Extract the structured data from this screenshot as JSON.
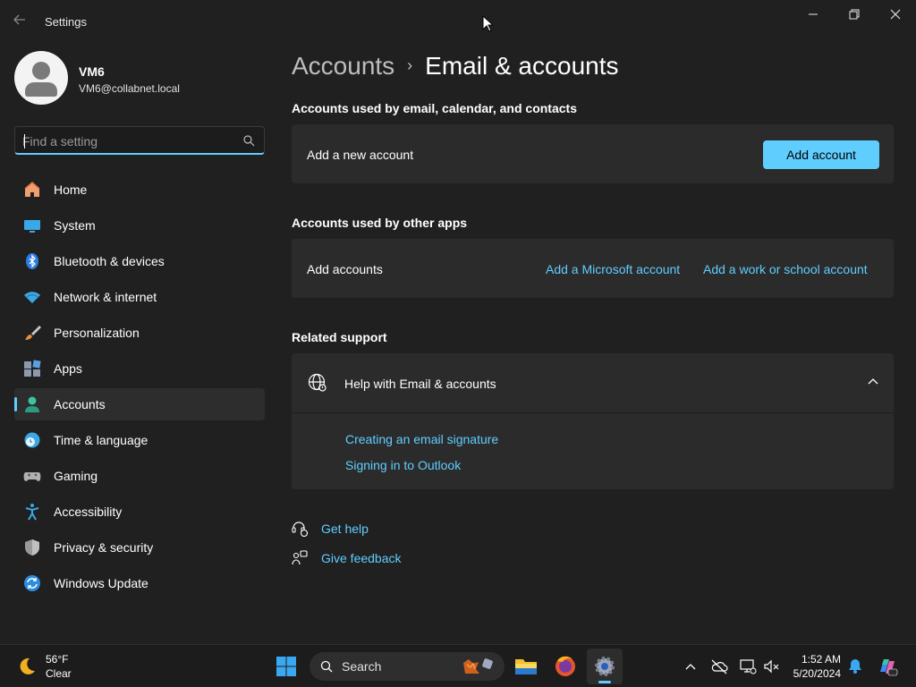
{
  "window": {
    "app_title": "Settings",
    "minimize_icon": "minimize-icon",
    "restore_icon": "restore-icon",
    "close_icon": "close-icon"
  },
  "profile": {
    "name": "VM6",
    "email": "VM6@collabnet.local"
  },
  "search": {
    "placeholder": "Find a setting",
    "value": ""
  },
  "sidebar": {
    "items": [
      {
        "label": "Home",
        "icon": "home-icon",
        "active": false
      },
      {
        "label": "System",
        "icon": "system-icon",
        "active": false
      },
      {
        "label": "Bluetooth & devices",
        "icon": "bluetooth-icon",
        "active": false
      },
      {
        "label": "Network & internet",
        "icon": "wifi-icon",
        "active": false
      },
      {
        "label": "Personalization",
        "icon": "brush-icon",
        "active": false
      },
      {
        "label": "Apps",
        "icon": "apps-icon",
        "active": false
      },
      {
        "label": "Accounts",
        "icon": "accounts-icon",
        "active": true
      },
      {
        "label": "Time & language",
        "icon": "clock-globe-icon",
        "active": false
      },
      {
        "label": "Gaming",
        "icon": "gamepad-icon",
        "active": false
      },
      {
        "label": "Accessibility",
        "icon": "accessibility-icon",
        "active": false
      },
      {
        "label": "Privacy & security",
        "icon": "shield-icon",
        "active": false
      },
      {
        "label": "Windows Update",
        "icon": "update-icon",
        "active": false
      }
    ]
  },
  "main": {
    "breadcrumb": {
      "parent": "Accounts",
      "separator": "›",
      "current": "Email & accounts"
    },
    "section1": {
      "title": "Accounts used by email, calendar, and contacts",
      "row_label": "Add a new account",
      "button_label": "Add account"
    },
    "section2": {
      "title": "Accounts used by other apps",
      "row_label": "Add accounts",
      "link_microsoft": "Add a Microsoft account",
      "link_work": "Add a work or school account"
    },
    "related": {
      "title": "Related support",
      "expander_title": "Help with Email & accounts",
      "links": [
        "Creating an email signature",
        "Signing in to Outlook"
      ]
    },
    "bottom_links": {
      "get_help": "Get help",
      "give_feedback": "Give feedback"
    }
  },
  "taskbar": {
    "weather_temp": "56°F",
    "weather_condition": "Clear",
    "search_label": "Search",
    "time": "1:52 AM",
    "date": "5/20/2024"
  },
  "colors": {
    "accent": "#60cdff",
    "background": "#202020",
    "card": "#2b2b2b"
  }
}
